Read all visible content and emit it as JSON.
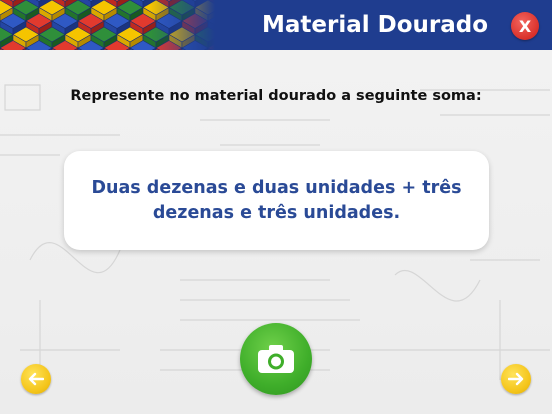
{
  "header": {
    "title": "Material Dourado",
    "close_label": "X",
    "colors": {
      "bar": "#1f3d8f",
      "close": "#d9302a"
    }
  },
  "instruction": "Represente no material dourado a seguinte soma:",
  "card": {
    "text": "Duas dezenas e duas unidades + três dezenas e três unidades."
  },
  "icons": {
    "close": "close-icon",
    "camera": "camera-icon",
    "prev": "arrow-left-icon",
    "next": "arrow-right-icon",
    "logo": "colored-cubes-pattern"
  },
  "colors": {
    "text_blue": "#2a4a96",
    "camera": "#3fae2a",
    "nav": "#f4c419"
  }
}
